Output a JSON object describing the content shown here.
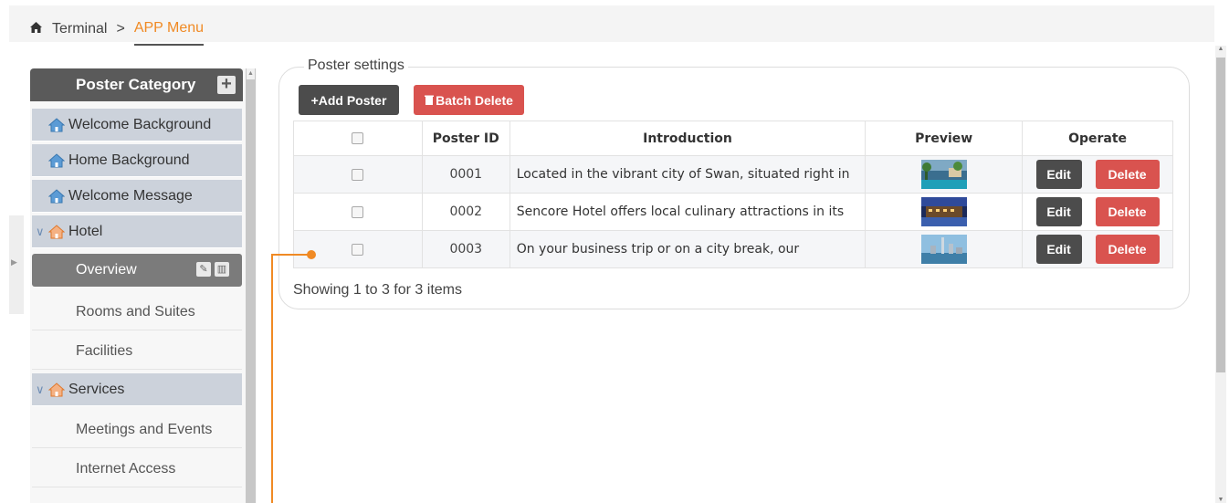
{
  "breadcrumb": {
    "home_icon": "home-icon",
    "items": [
      "Terminal",
      "APP Menu"
    ],
    "separator": ">"
  },
  "sidebar": {
    "title": "Poster Category",
    "add_icon": "plus-icon",
    "items": [
      {
        "label": "Welcome Background",
        "icon": "house-icon"
      },
      {
        "label": "Home Background",
        "icon": "house-icon"
      },
      {
        "label": "Welcome Message",
        "icon": "house-icon"
      },
      {
        "label": "Hotel",
        "icon": "house-icon",
        "expanded": true
      },
      {
        "label": "Overview",
        "selected": true
      },
      {
        "label": "Rooms and Suites"
      },
      {
        "label": "Facilities"
      },
      {
        "label": "Services",
        "icon": "house-icon",
        "expanded": true
      },
      {
        "label": "Meetings and Events"
      },
      {
        "label": "Internet Access"
      }
    ]
  },
  "panel": {
    "title": "Poster settings",
    "add_label": "+Add Poster",
    "batch_delete_label": "Batch Delete",
    "columns": [
      "Poster ID",
      "Introduction",
      "Preview",
      "Operate"
    ],
    "rows": [
      {
        "id": "0001",
        "intro": "Located in the vibrant city of Swan, situated right in",
        "preview": "hotel-pool-thumbnail"
      },
      {
        "id": "0002",
        "intro": "Sencore Hotel offers local culinary attractions in its",
        "preview": "hotel-night-thumbnail"
      },
      {
        "id": "0003",
        "intro": "On your business trip or on a city break, our",
        "preview": "city-skyline-thumbnail"
      }
    ],
    "edit_label": "Edit",
    "delete_label": "Delete",
    "footer": "Showing 1 to 3 for 3 items"
  },
  "colors": {
    "accent": "#f08a24",
    "danger": "#d9534f",
    "dark_button": "#4c4c4c",
    "sidebar_header": "#5a5a5a"
  }
}
